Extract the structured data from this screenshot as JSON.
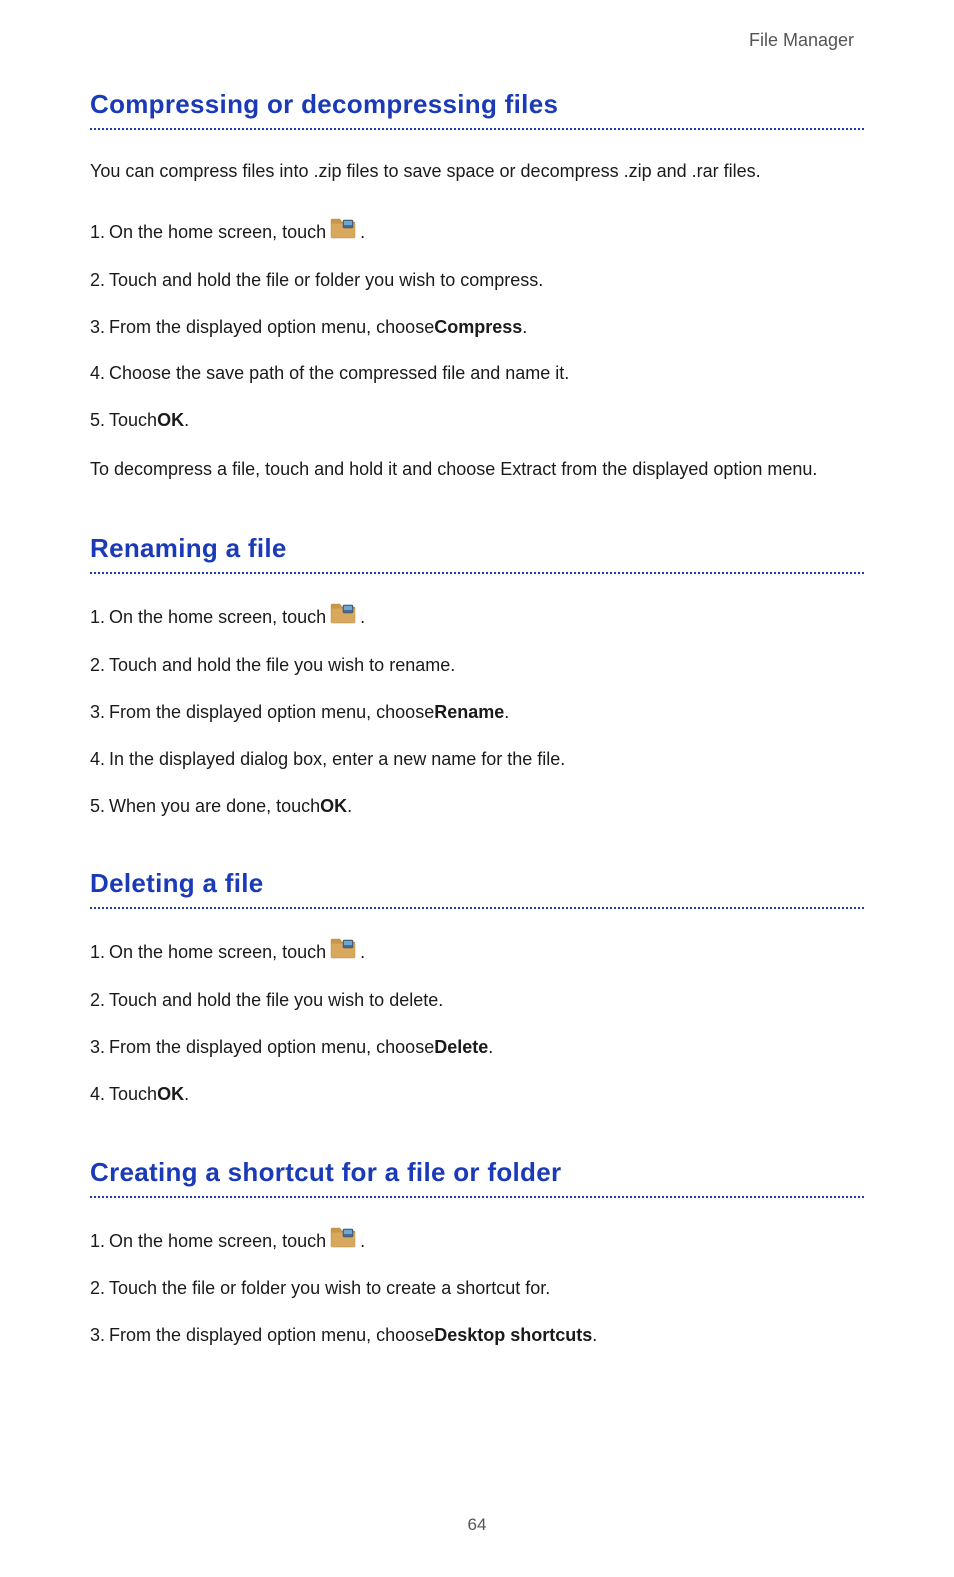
{
  "header": {
    "title": "File Manager"
  },
  "sections": [
    {
      "title": "Compressing or decompressing files",
      "intro": "You can compress files into .zip files to save space or decompress .zip and .rar files.",
      "steps": [
        {
          "num": "1.",
          "pre": "On the home screen, touch ",
          "icon": true,
          "post": "."
        },
        {
          "num": "2.",
          "pre": "Touch and hold the file or folder you wish to compress."
        },
        {
          "num": "3.",
          "pre": "From the displayed option menu, choose ",
          "bold": "Compress",
          "post": "."
        },
        {
          "num": "4.",
          "pre": "Choose the save path of the compressed file and name it."
        },
        {
          "num": "5.",
          "pre": "Touch ",
          "bold": "OK",
          "post": "."
        }
      ],
      "note_pre": "To decompress a file, touch and hold it and choose ",
      "note_bold": "Extract",
      "note_post": " from the displayed option menu."
    },
    {
      "title": "Renaming a file",
      "steps": [
        {
          "num": "1.",
          "pre": "On the home screen, touch ",
          "icon": true,
          "post": "."
        },
        {
          "num": "2.",
          "pre": "Touch and hold the file you wish to rename."
        },
        {
          "num": "3.",
          "pre": "From the displayed option menu, choose ",
          "bold": "Rename",
          "post": "."
        },
        {
          "num": "4.",
          "pre": "In the displayed dialog box, enter a new name for the file."
        },
        {
          "num": "5.",
          "pre": "When you are done, touch ",
          "bold": "OK",
          "post": "."
        }
      ]
    },
    {
      "title": "Deleting a file",
      "steps": [
        {
          "num": "1.",
          "pre": "On the home screen, touch ",
          "icon": true,
          "post": "."
        },
        {
          "num": "2.",
          "pre": "Touch and hold the file you wish to delete."
        },
        {
          "num": "3.",
          "pre": "From the displayed option menu, choose ",
          "bold": "Delete",
          "post": "."
        },
        {
          "num": "4.",
          "pre": "Touch ",
          "bold": "OK",
          "post": "."
        }
      ]
    },
    {
      "title": "Creating a shortcut for a file or folder",
      "steps": [
        {
          "num": "1.",
          "pre": "On the home screen, touch ",
          "icon": true,
          "post": "."
        },
        {
          "num": "2.",
          "pre": "Touch the file or folder you wish to create a shortcut for."
        },
        {
          "num": "3.",
          "pre": "From the displayed option menu, choose ",
          "bold": "Desktop shortcuts",
          "post": "."
        }
      ]
    }
  ],
  "page_number": "64"
}
